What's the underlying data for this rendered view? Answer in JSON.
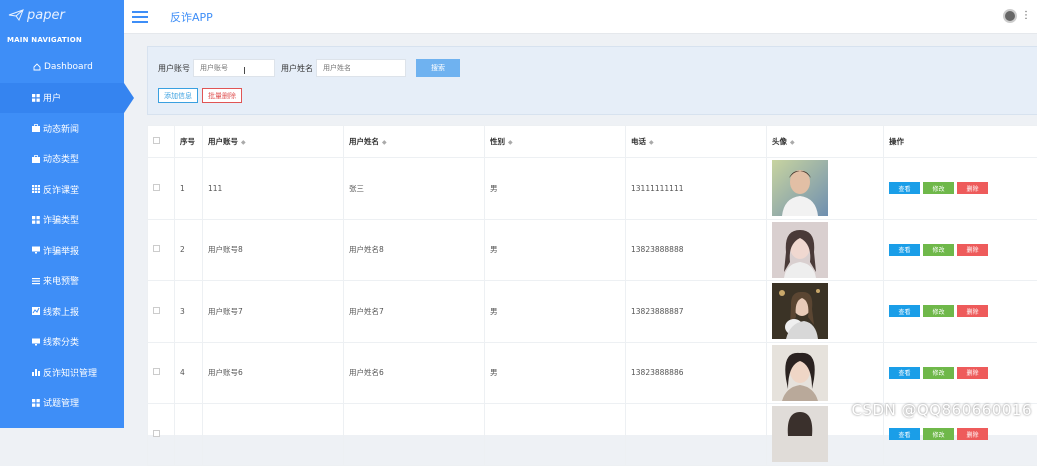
{
  "brand": {
    "logo_text": "paper"
  },
  "sidebar": {
    "header": "MAIN NAVIGATION",
    "items": [
      {
        "label": "Dashboard",
        "icon": "home-icon"
      },
      {
        "label": "用户",
        "icon": "grid-icon",
        "active": true
      },
      {
        "label": "动态新闻",
        "icon": "briefcase-icon"
      },
      {
        "label": "动态类型",
        "icon": "briefcase-icon"
      },
      {
        "label": "反诈课堂",
        "icon": "grid-icon"
      },
      {
        "label": "诈骗类型",
        "icon": "grid-icon"
      },
      {
        "label": "诈骗举报",
        "icon": "monitor-icon"
      },
      {
        "label": "来电预警",
        "icon": "list-icon"
      },
      {
        "label": "线索上报",
        "icon": "chart-icon"
      },
      {
        "label": "线索分类",
        "icon": "monitor-icon"
      },
      {
        "label": "反诈知识管理",
        "icon": "bar-chart-icon"
      },
      {
        "label": "试题管理",
        "icon": "grid-icon"
      }
    ]
  },
  "topbar": {
    "title": "反诈APP"
  },
  "search": {
    "account_label": "用户账号",
    "account_placeholder": "用户账号",
    "name_label": "用户姓名",
    "name_placeholder": "用户姓名",
    "search_button": "搜索",
    "add_button": "添加信息",
    "batch_delete_button": "批量删除"
  },
  "table": {
    "headers": [
      "序号",
      "用户账号",
      "用户姓名",
      "性别",
      "电话",
      "头像",
      "操作"
    ],
    "rows": [
      {
        "index": "1",
        "account": "111",
        "name": "张三",
        "gender": "男",
        "phone": "13111111111"
      },
      {
        "index": "2",
        "account": "用户账号8",
        "name": "用户姓名8",
        "gender": "男",
        "phone": "13823888888"
      },
      {
        "index": "3",
        "account": "用户账号7",
        "name": "用户姓名7",
        "gender": "男",
        "phone": "13823888887"
      },
      {
        "index": "4",
        "account": "用户账号6",
        "name": "用户姓名6",
        "gender": "男",
        "phone": "13823888886"
      }
    ],
    "actions": {
      "view": "查看",
      "edit": "修改",
      "delete": "删除"
    }
  },
  "watermark": "CSDN @QQ860660016",
  "colors": {
    "sidebar": "#3e8ef7",
    "view": "#1a9ee8",
    "edit": "#6fb84a",
    "delete": "#ee5b5b"
  }
}
